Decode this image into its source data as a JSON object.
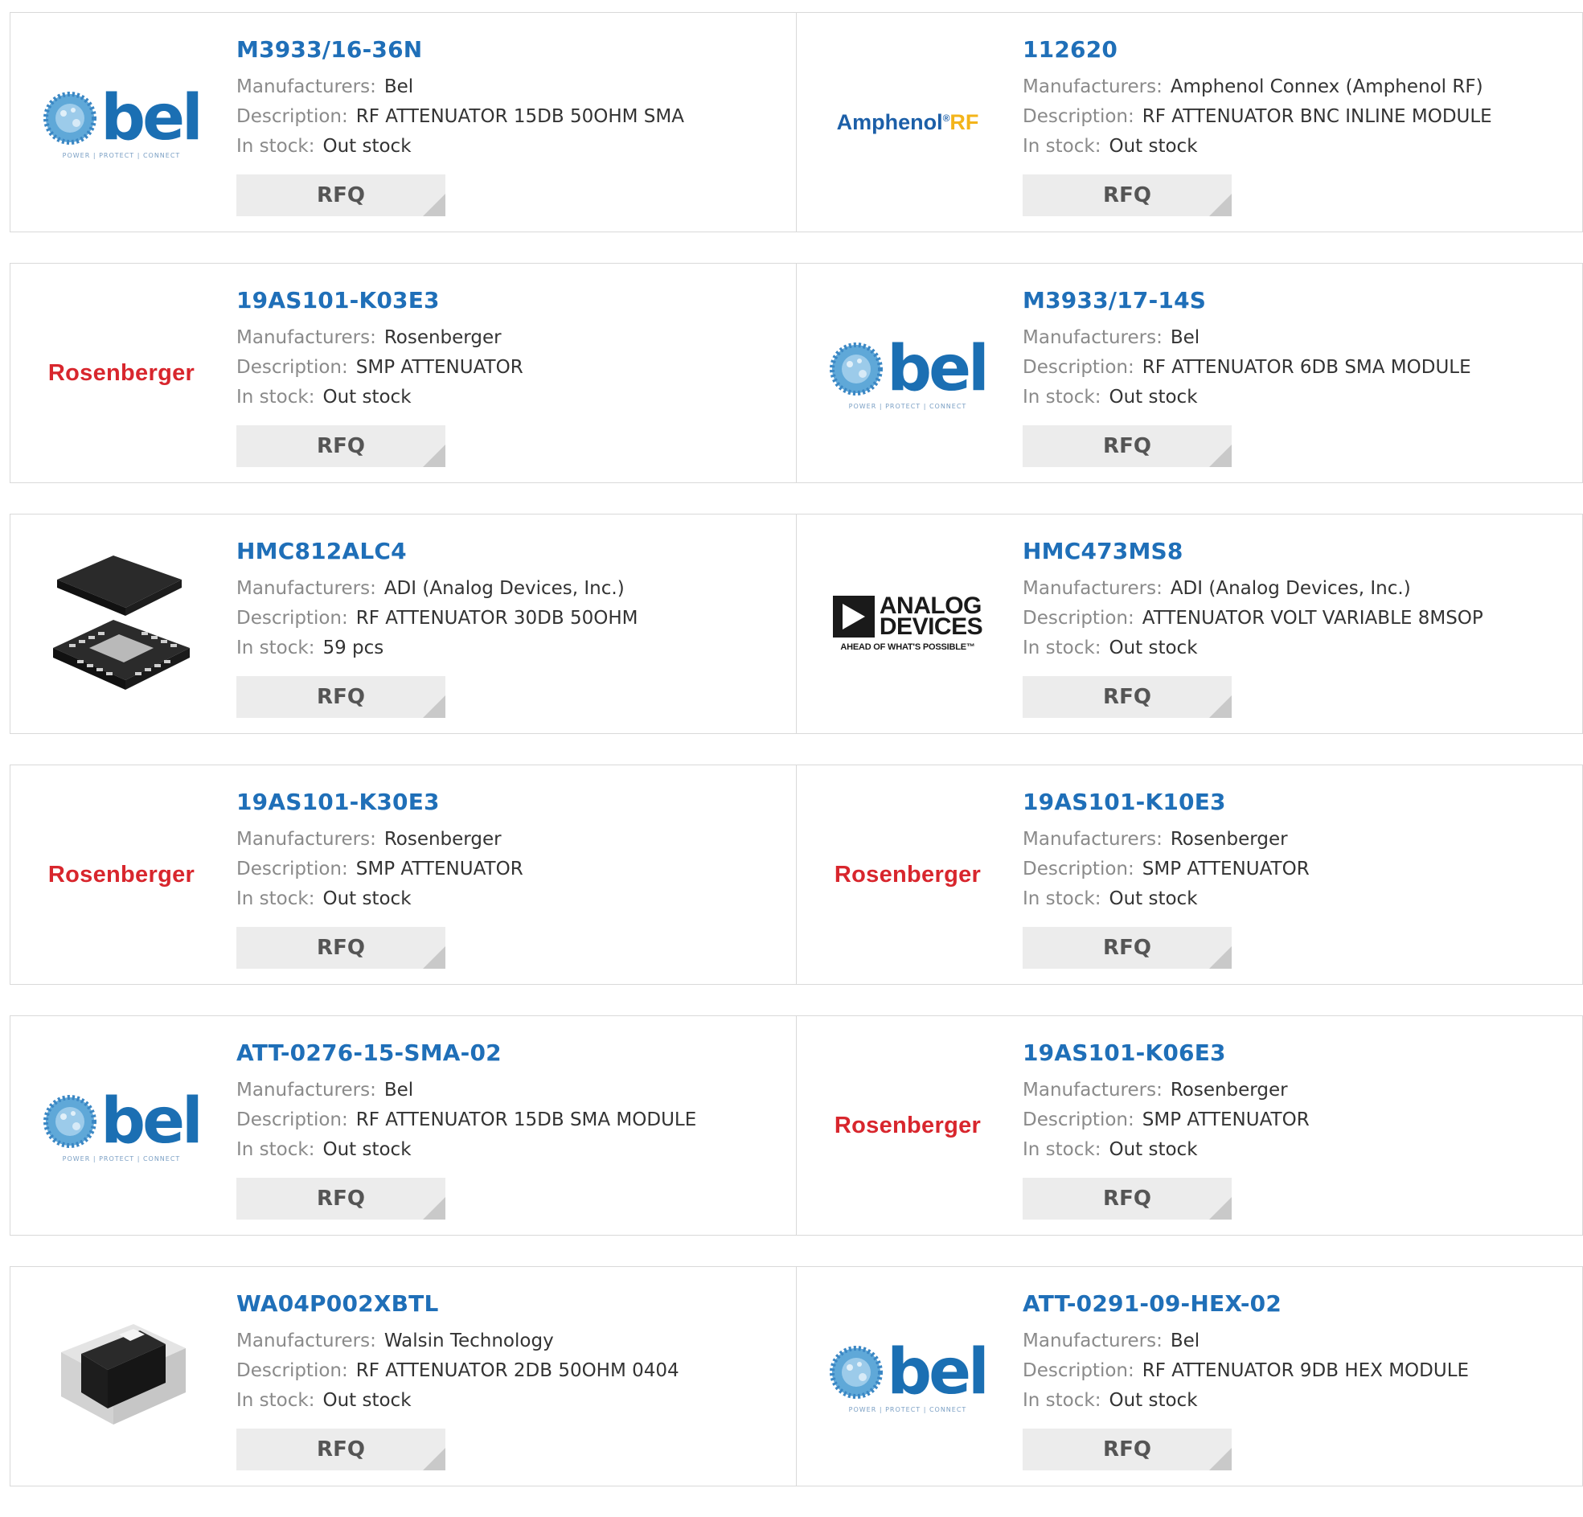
{
  "labels": {
    "manufacturers": "Manufacturers:",
    "description": "Description:",
    "in_stock": "In stock:"
  },
  "rfq_label": "RFQ",
  "logo_text": {
    "bel": "bel",
    "bel_tagline": "POWER | PROTECT | CONNECT",
    "rosenberger": "Rosenberger",
    "amphenol": "Amphenol",
    "amphenol_rf": "RF",
    "adi_line1": "ANALOG",
    "adi_line2": "DEVICES",
    "adi_tagline": "AHEAD OF WHAT'S POSSIBLE™"
  },
  "products": [
    {
      "part": "M3933/16-36N",
      "manufacturer": "Bel",
      "description": "RF ATTENUATOR 15DB 50OHM SMA",
      "stock": "Out stock",
      "logo": "bel-logo"
    },
    {
      "part": "112620",
      "manufacturer": "Amphenol Connex (Amphenol RF)",
      "description": "RF ATTENUATOR BNC INLINE MODULE",
      "stock": "Out stock",
      "logo": "amphenol-rf-logo"
    },
    {
      "part": "19AS101-K03E3",
      "manufacturer": "Rosenberger",
      "description": "SMP ATTENUATOR",
      "stock": "Out stock",
      "logo": "rosenberger-logo"
    },
    {
      "part": "M3933/17-14S",
      "manufacturer": "Bel",
      "description": "RF ATTENUATOR 6DB SMA MODULE",
      "stock": "Out stock",
      "logo": "bel-logo"
    },
    {
      "part": "HMC812ALC4",
      "manufacturer": "ADI (Analog Devices, Inc.)",
      "description": "RF ATTENUATOR 30DB 50OHM",
      "stock": "59 pcs",
      "logo": "qfn-chip-image"
    },
    {
      "part": "HMC473MS8",
      "manufacturer": "ADI (Analog Devices, Inc.)",
      "description": "ATTENUATOR VOLT VARIABLE 8MSOP",
      "stock": "Out stock",
      "logo": "analog-devices-logo"
    },
    {
      "part": "19AS101-K30E3",
      "manufacturer": "Rosenberger",
      "description": "SMP ATTENUATOR",
      "stock": "Out stock",
      "logo": "rosenberger-logo"
    },
    {
      "part": "19AS101-K10E3",
      "manufacturer": "Rosenberger",
      "description": "SMP ATTENUATOR",
      "stock": "Out stock",
      "logo": "rosenberger-logo"
    },
    {
      "part": "ATT-0276-15-SMA-02",
      "manufacturer": "Bel",
      "description": "RF ATTENUATOR 15DB SMA MODULE",
      "stock": "Out stock",
      "logo": "bel-logo"
    },
    {
      "part": "19AS101-K06E3",
      "manufacturer": "Rosenberger",
      "description": "SMP ATTENUATOR",
      "stock": "Out stock",
      "logo": "rosenberger-logo"
    },
    {
      "part": "WA04P002XBTL",
      "manufacturer": "Walsin Technology",
      "description": "RF ATTENUATOR 2DB 50OHM 0404",
      "stock": "Out stock",
      "logo": "chip-resistor-image"
    },
    {
      "part": "ATT-0291-09-HEX-02",
      "manufacturer": "Bel",
      "description": "RF ATTENUATOR 9DB HEX MODULE",
      "stock": "Out stock",
      "logo": "bel-logo"
    }
  ],
  "colors": {
    "part_link": "#1f6fb8",
    "label_gray": "#8a8a8a",
    "value_text": "#333333",
    "rfq_bg": "#ececec",
    "border": "#d9d9d9",
    "bel_blue": "#1b6fb3",
    "rosenberger_red": "#d8262d",
    "amphenol_yellow": "#f3b41a"
  }
}
